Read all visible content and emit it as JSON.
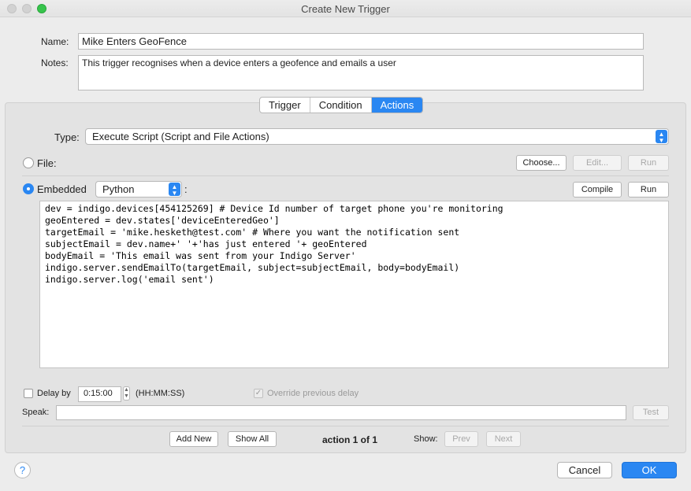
{
  "window": {
    "title": "Create New Trigger"
  },
  "form": {
    "name_label": "Name:",
    "name_value": "Mike Enters GeoFence",
    "notes_label": "Notes:",
    "notes_value": "This trigger recognises when a device enters a geofence and emails a user"
  },
  "tabs": [
    "Trigger",
    "Condition",
    "Actions"
  ],
  "selected_tab": "Actions",
  "action": {
    "type_label": "Type:",
    "type_value": "Execute Script (Script and File Actions)",
    "file_label": "File:",
    "choose_button": "Choose...",
    "edit_button": "Edit...",
    "file_run_button": "Run",
    "embedded_label": "Embedded",
    "language_value": "Python",
    "language_suffix": ":",
    "compile_button": "Compile",
    "embedded_run_button": "Run",
    "code": "dev = indigo.devices[454125269] # Device Id number of target phone you're monitoring\ngeoEntered = dev.states['deviceEnteredGeo']\ntargetEmail = 'mike.hesketh@test.com' # Where you want the notification sent\nsubjectEmail = dev.name+' '+'has just entered '+ geoEntered\nbodyEmail = 'This email was sent from your Indigo Server'\nindigo.server.sendEmailTo(targetEmail, subject=subjectEmail, body=bodyEmail)\nindigo.server.log('email sent')"
  },
  "delay": {
    "label": "Delay by",
    "value": "0:15:00",
    "format": "(HH:MM:SS)",
    "override_label": "Override previous delay",
    "override_checked": true
  },
  "speak": {
    "label": "Speak:",
    "value": "",
    "test_button": "Test"
  },
  "footer": {
    "add_new": "Add New",
    "show_all": "Show All",
    "counter": "action 1 of 1",
    "show_label": "Show:",
    "prev": "Prev",
    "next": "Next"
  },
  "dialog": {
    "help": "?",
    "cancel": "Cancel",
    "ok": "OK"
  },
  "colors": {
    "accent": "#2a87f2"
  },
  "icons": [
    "close-icon",
    "minimize-icon",
    "zoom-icon",
    "chevron-updown-icon",
    "help-icon"
  ]
}
